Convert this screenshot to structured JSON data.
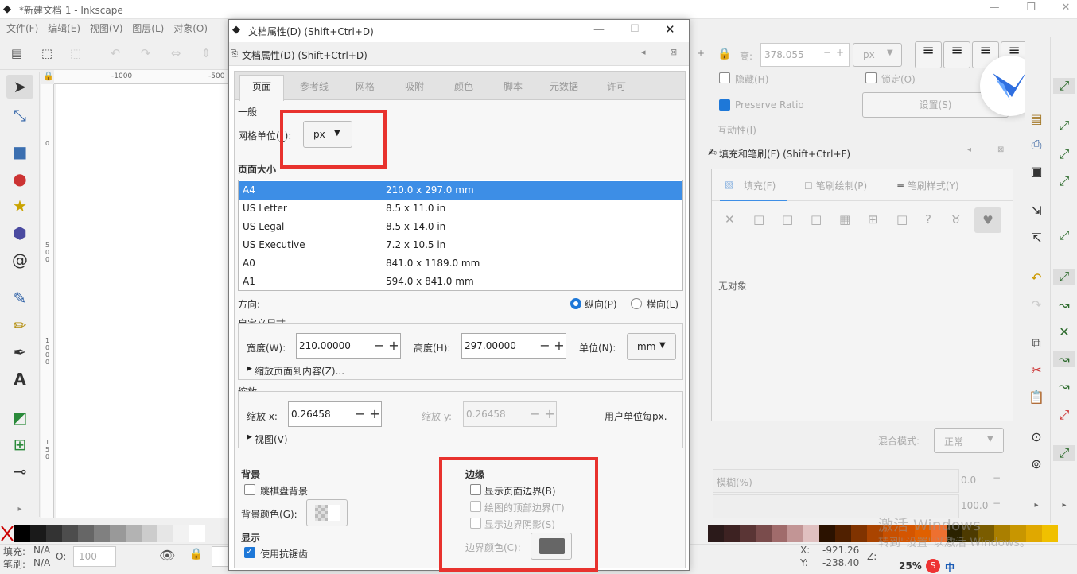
{
  "app": {
    "title": "*新建文档 1 - Inkscape",
    "menu": [
      "文件(F)",
      "编辑(E)",
      "视图(V)",
      "图层(L)",
      "对象(O)"
    ]
  },
  "ruler": {
    "h_ticks": [
      "-1000",
      "-500"
    ],
    "v_ticks": [
      "0",
      "5\n0\n0",
      "1\n0\n0\n0",
      "1\n5\n0"
    ]
  },
  "dialog": {
    "title": "文档属性(D) (Shift+Ctrl+D)",
    "subtitle": "文档属性(D) (Shift+Ctrl+D)",
    "tabs": [
      "页面",
      "参考线",
      "网格",
      "吸附",
      "颜色",
      "脚本",
      "元数据",
      "许可"
    ],
    "general": {
      "heading": "一般",
      "grid_unit_label": "网格单位(_):",
      "grid_unit_value": "px"
    },
    "page_size": {
      "heading": "页面大小",
      "rows": [
        {
          "name": "A4",
          "size": "210.0 x 297.0 mm"
        },
        {
          "name": "US Letter",
          "size": "8.5 x 11.0 in"
        },
        {
          "name": "US Legal",
          "size": "8.5 x 14.0 in"
        },
        {
          "name": "US Executive",
          "size": "7.2 x 10.5 in"
        },
        {
          "name": "A0",
          "size": "841.0 x 1189.0 mm"
        },
        {
          "name": "A1",
          "size": "594.0 x 841.0 mm"
        }
      ]
    },
    "orientation": {
      "label": "方向:",
      "portrait": "纵向(P)",
      "landscape": "横向(L)"
    },
    "custom": {
      "heading": "自定义尺寸",
      "width_label": "宽度(W):",
      "width_value": "210.00000",
      "height_label": "高度(H):",
      "height_value": "297.00000",
      "unit_label": "单位(N):",
      "unit_value": "mm",
      "fit_label": "缩放页面到内容(Z)..."
    },
    "scale": {
      "heading": "缩放",
      "x_label": "缩放 x:",
      "x_value": "0.26458",
      "y_label": "缩放 y:",
      "y_value": "0.26458",
      "user_units": "用户单位每px.",
      "view_label": "视图(V)"
    },
    "background": {
      "heading": "背景",
      "checker_label": "跳棋盘背景",
      "color_label": "背景颜色(G):"
    },
    "display": {
      "heading": "显示",
      "antialias_label": "使用抗锯齿"
    },
    "border": {
      "heading": "边缘",
      "show_border": "显示页面边界(B)",
      "border_top": "绘图的顶部边界(T)",
      "show_shadow": "显示边界阴影(S)",
      "color_label": "边界颜色(C):"
    }
  },
  "right_panel": {
    "height_label": "高:",
    "height_value": "378.055",
    "unit": "px",
    "hide_label": "隐藏(H)",
    "lock_label": "锁定(O)",
    "preserve_ratio": "Preserve Ratio",
    "settings_btn": "设置(S)",
    "interactivity": "互动性(I)",
    "fill_stroke_title": "填充和笔刷(F) (Shift+Ctrl+F)",
    "fill_tabs": [
      "填充(F)",
      "笔刷绘制(P)",
      "笔刷样式(Y)"
    ],
    "no_object": "无对象",
    "blend_label": "混合模式:",
    "blend_value": "正常",
    "blur_label": "模糊(%)",
    "blur_value": "0.0",
    "opacity_value": "100.0"
  },
  "status": {
    "fill_label": "填充:",
    "fill_value": "N/A",
    "stroke_label": "笔刷:",
    "stroke_value": "N/A",
    "o_label": "O:",
    "o_value": "100",
    "x_label": "X:",
    "x_value": "-921.26",
    "y_label": "Y:",
    "y_value": "-238.40",
    "z_label": "Z:",
    "zoom": "25%",
    "ime": "中"
  },
  "watermark": {
    "line1": "激活 Windows",
    "line2": "转到\"设置\"以激活 Windows。"
  },
  "colors": {
    "accent": "#3d8ee6",
    "highlight_box": "#e8322e",
    "border_color_swatch": "#666666"
  }
}
